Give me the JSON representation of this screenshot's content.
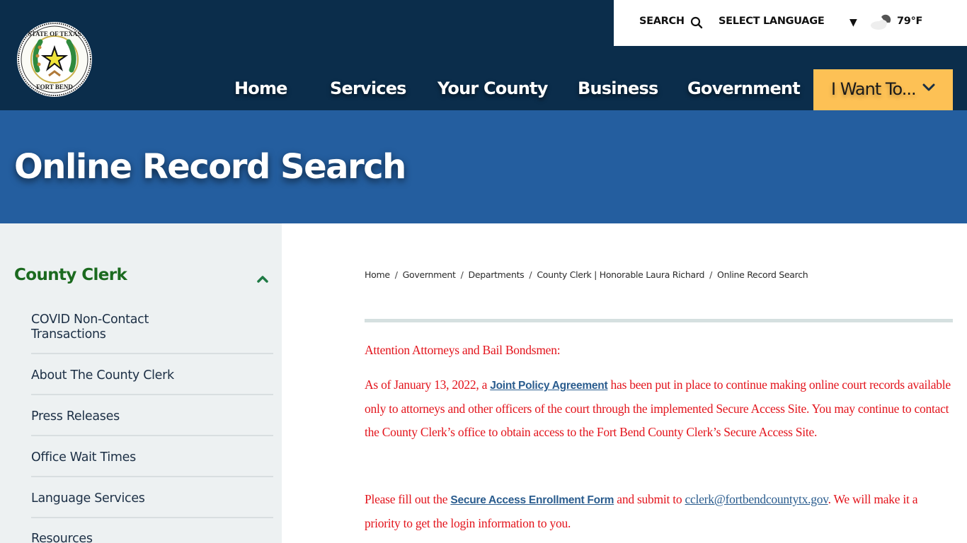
{
  "header": {
    "logo_alt": "The State of Texas - Fort Bend County seal",
    "utility": {
      "search_label": "SEARCH",
      "language_label": "SELECT LANGUAGE",
      "language_arrow": "▼",
      "temperature": "79°F"
    },
    "nav": {
      "items": [
        {
          "label": "Home"
        },
        {
          "label": "Services"
        },
        {
          "label": "Your County"
        },
        {
          "label": "Business"
        },
        {
          "label": "Government"
        }
      ],
      "cta_label": "I Want To..."
    }
  },
  "banner": {
    "title": "Online Record Search"
  },
  "sidebar": {
    "heading": "County Clerk",
    "items": [
      {
        "label": "COVID Non-Contact Transactions"
      },
      {
        "label": "About The County Clerk"
      },
      {
        "label": "Press Releases"
      },
      {
        "label": "Office Wait Times"
      },
      {
        "label": "Language Services"
      },
      {
        "label": "Resources"
      }
    ]
  },
  "breadcrumb": [
    {
      "label": "Home"
    },
    {
      "label": "Government"
    },
    {
      "label": "Departments"
    },
    {
      "label": "County Clerk | Honorable Laura Richard"
    },
    {
      "label": "Online Record Search"
    }
  ],
  "content": {
    "attention": "Attention Attorneys and Bail Bondsmen:",
    "p1_before": "As of January 13, 2022, a ",
    "p1_link": "Joint Policy Agreement",
    "p1_after": " has been put in place to continue making online court records available only to attorneys and other officers of the court through the implemented Secure Access Site. You may continue to contact the County Clerk’s office to obtain access to the Fort Bend County Clerk’s Secure Access Site.",
    "p2_before": "Please fill out the ",
    "p2_link": "Secure Access Enrollment Form",
    "p2_middle": " and submit to ",
    "p2_email": "cclerk@fortbendcountytx.gov",
    "p2_after": ".  We will make it a priority to get the login information to you."
  },
  "colors": {
    "header_bg": "#0b2d4b",
    "banner_bg": "#245e9f",
    "cta_bg": "#fdc155",
    "sidebar_bg": "#edf1f2",
    "sidebar_heading": "#1b6a1f",
    "body_text": "#e3141c",
    "link": "#2a5c8e"
  }
}
